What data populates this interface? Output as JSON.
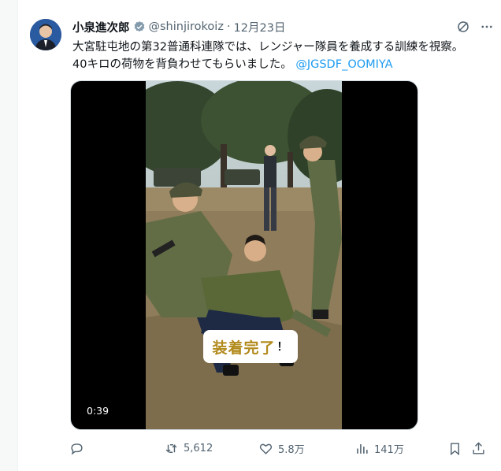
{
  "post": {
    "author_name": "小泉進次郎",
    "handle": "@shinjirokoiz",
    "separator": "·",
    "date": "12月23日",
    "text_line1": "大宮駐屯地の第32普通科連隊では、レンジャー隊員を養成する訓練を視察。",
    "text_line2_prefix": "40キロの荷物を背負わせてもらいました。",
    "mention": "@JGSDF_OOMIYA"
  },
  "media": {
    "caption": "装着完了",
    "caption_suffix": "！",
    "duration": "0:39"
  },
  "actions": {
    "reply_count": "",
    "repost_count": "5,612",
    "like_count": "5.8万",
    "views_count": "141万"
  },
  "icons": [
    "verified-badge-icon",
    "grok-icon",
    "more-icon",
    "reply-icon",
    "repost-icon",
    "like-icon",
    "views-icon",
    "bookmark-icon",
    "share-icon"
  ],
  "colors": {
    "accent": "#1d9bf0",
    "muted": "#536471",
    "text": "#0f1419",
    "caption_gold": "#b28a1c"
  }
}
